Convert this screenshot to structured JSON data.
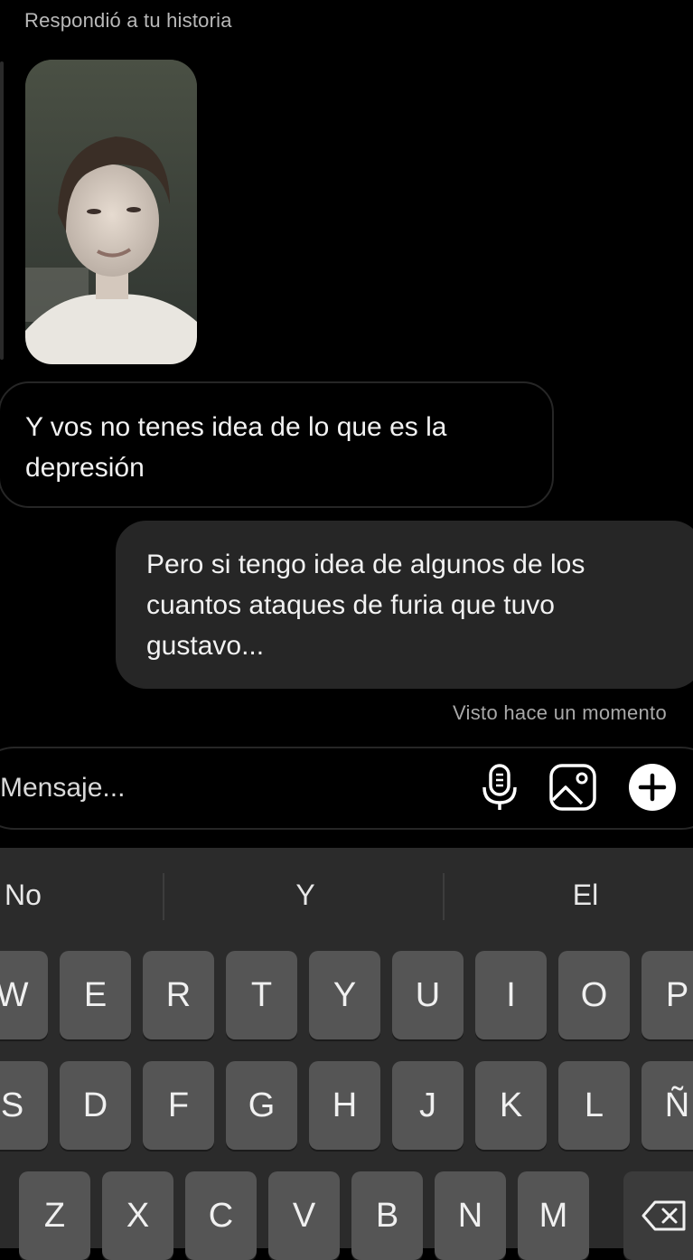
{
  "header": {
    "reply_caption": "Respondió a tu historia"
  },
  "messages": {
    "received": {
      "line1": "Y vos no tenes idea de lo que es la",
      "line2": "depresión"
    },
    "sent": {
      "line1": "Pero si tengo idea de algunos de los",
      "line2": "cuantos ataques de furia que tuvo",
      "line3": "gustavo..."
    },
    "seen_status": "Visto hace un momento"
  },
  "composer": {
    "placeholder": "Mensaje...",
    "icons": [
      "microphone-icon",
      "image-gallery-icon",
      "add-icon"
    ]
  },
  "keyboard": {
    "suggestions": [
      "No",
      "Y",
      "El"
    ],
    "row1": [
      "W",
      "E",
      "R",
      "T",
      "Y",
      "U",
      "I",
      "O",
      "P"
    ],
    "row2": [
      "S",
      "D",
      "F",
      "G",
      "H",
      "J",
      "K",
      "L",
      "Ñ"
    ],
    "row3": [
      "Z",
      "X",
      "C",
      "V",
      "B",
      "N",
      "M"
    ],
    "backspace_icon": "backspace-icon"
  },
  "colors": {
    "background": "#000000",
    "sent_bubble": "#262626",
    "key": "#555555",
    "keyboard": "#2b2b2b"
  }
}
